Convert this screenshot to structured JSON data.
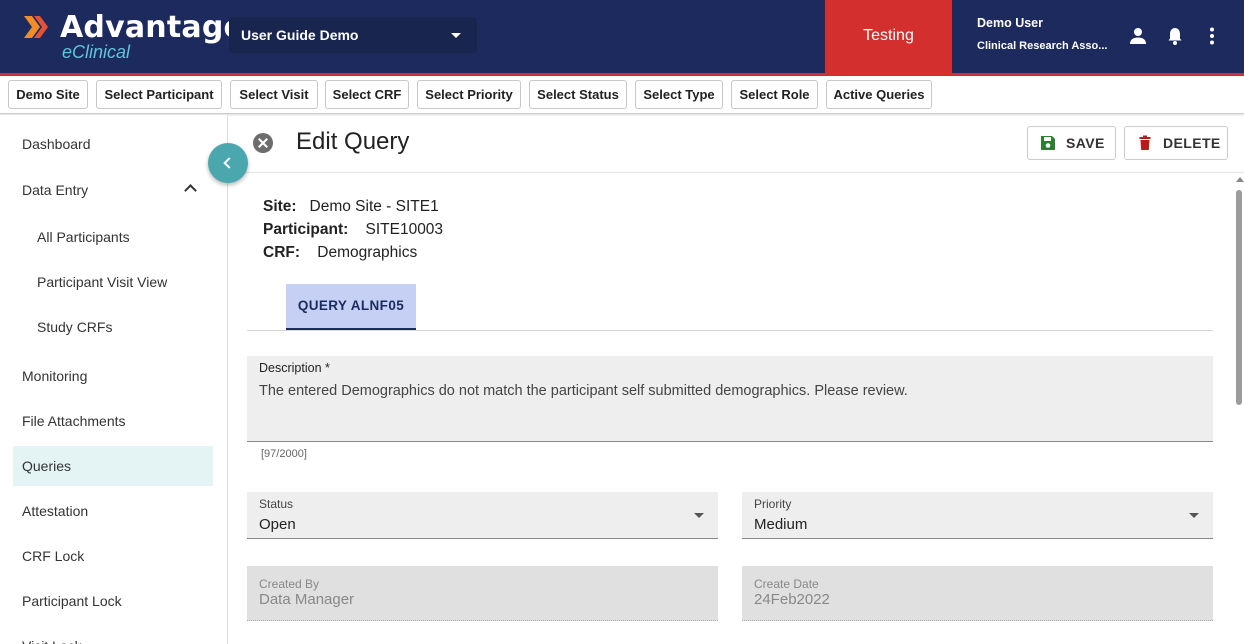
{
  "header": {
    "logo_title": "Advantage",
    "logo_subtitle": "eClinical",
    "study": "User Guide Demo",
    "environment": "Testing",
    "user_name": "Demo User",
    "user_role": "Clinical Research Asso...",
    "colors": {
      "bar": "#1c2a5e",
      "env": "#d32f2f",
      "accent": "#4aa7ae"
    }
  },
  "filters": [
    "Demo Site",
    "Select Participant",
    "Select Visit",
    "Select CRF",
    "Select Priority",
    "Select Status",
    "Select Type",
    "Select Role",
    "Active Queries"
  ],
  "sidebar": {
    "items": [
      {
        "label": "Dashboard"
      },
      {
        "label": "Data Entry",
        "expanded": true
      },
      {
        "label": "All Participants"
      },
      {
        "label": "Participant Visit View"
      },
      {
        "label": "Study CRFs"
      },
      {
        "label": "Monitoring"
      },
      {
        "label": "File Attachments"
      },
      {
        "label": "Queries",
        "active": true
      },
      {
        "label": "Attestation"
      },
      {
        "label": "CRF Lock"
      },
      {
        "label": "Participant Lock"
      },
      {
        "label": "Visit Lock"
      }
    ]
  },
  "page": {
    "title": "Edit Query",
    "save_label": "SAVE",
    "delete_label": "DELETE",
    "site_label": "Site:",
    "site_value": "Demo Site - SITE1",
    "participant_label": "Participant:",
    "participant_value": "SITE10003",
    "crf_label": "CRF:",
    "crf_value": "Demographics",
    "tab_label": "QUERY ALNF05"
  },
  "form": {
    "description_label": "Description *",
    "description_value": "The entered Demographics do not match the participant self submitted demographics. Please review.",
    "description_counter": "[97/2000]",
    "status_label": "Status",
    "status_value": "Open",
    "priority_label": "Priority",
    "priority_value": "Medium",
    "created_by_label": "Created By",
    "created_by_value": "Data Manager",
    "create_date_label": "Create Date",
    "create_date_value": "24Feb2022"
  }
}
